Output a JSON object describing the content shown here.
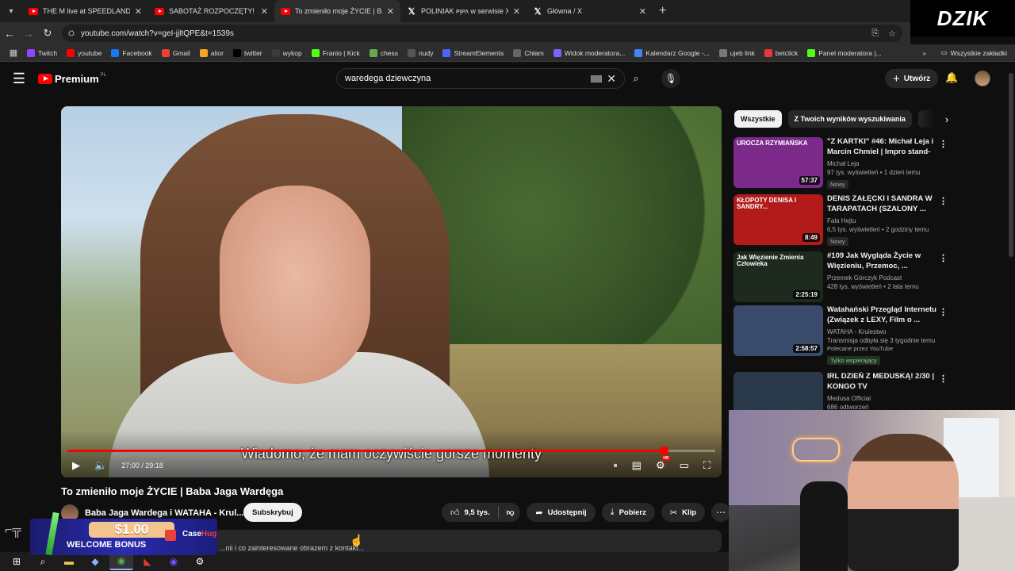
{
  "browser": {
    "tabs": [
      {
        "title": "THE M live at SPEEDLAND FEST",
        "icon": "youtube-icon"
      },
      {
        "title": "SABOTAŻ ROZPOCZĘTY! SABOT",
        "icon": "youtube-icon"
      },
      {
        "title": "To zmieniło moje ŻYCIE | Baba",
        "icon": "youtube-icon",
        "active": true
      },
      {
        "title": "POLINIAK ᴘᴉᴘᴧ w serwisie X: „Do",
        "icon": "x-icon"
      },
      {
        "title": "Główna / X",
        "icon": "x-icon"
      }
    ],
    "url": "youtube.com/watch?v=geI-jjltQPE&t=1539s",
    "overlay_logo": "DZIK",
    "bookmarks": [
      "Twitch",
      "youtube",
      "Facebook",
      "Gmail",
      "alior",
      "twitter",
      "wykop",
      "Franio | Kick",
      "chess",
      "nudy",
      "StreamElements",
      "Chłam",
      "Widok moderatora...",
      "Kalendarz Google -...",
      "ujeb link",
      "betclick",
      "Panel moderatora |..."
    ],
    "all_bookmarks": "Wszystkie zakładki"
  },
  "youtube": {
    "logo": "Premium",
    "logo_region": "PL",
    "search_query": "waredega dziewczyna",
    "create_label": "Utwórz"
  },
  "player": {
    "caption": "Wiadomo, że mam oczywiście gorsze momenty",
    "time": "27:00 / 29:18",
    "progress": 0.921
  },
  "video": {
    "title": "To zmieniło moje ŻYCIE | Baba Jaga Wardęga",
    "channel": "Baba Jaga Wardega i WATAHA - Krul...",
    "subscribe": "Subskrybuj",
    "likes": "9,5 tys.",
    "share": "Udostępnij",
    "download": "Pobierz",
    "clip": "Klip",
    "description_snippet": "...nii i co zainteresowane obrazem z kontakt..."
  },
  "sidebar": {
    "chips": [
      "Wszystkie",
      "Z Twoich wyników wyszukiwania"
    ],
    "recommendations": [
      {
        "title": "\"Z KARTKI\" #46: Michał Leja i Marcin Chmiel | Impro stand-u...",
        "channel": "Michał Leja",
        "views": "97 tys. wyświetleń • 1 dzień temu",
        "badge": "Nowy",
        "duration": "57:37",
        "thumb_text": "UROCZA RZYMIAŃSKA",
        "thumb_bg": "#7b2a8a"
      },
      {
        "title": "DENIS ZAŁĘCKI I SANDRA W TARAPATACH (SZALONY ...",
        "channel": "Fala Hejtu",
        "views": "6,5 tys. wyświetleń • 2 godziny temu",
        "badge": "Nowy",
        "duration": "8:49",
        "thumb_text": "KŁOPOTY DENISA I SANDRY...",
        "thumb_bg": "#b31a1a"
      },
      {
        "title": "#109 Jak Wygląda Życie w Więzieniu, Przemoc, ...",
        "channel": "Przemek Górczyk Podcast",
        "views": "428 tys. wyświetleń • 2 lata temu",
        "badge": "",
        "duration": "2:25:19",
        "thumb_text": "Jak Więzienie Zmienia Człowieka",
        "thumb_bg": "#1f2a1f"
      },
      {
        "title": "Watahański Przegląd Internetu (Związek z LEXY, Film o ...",
        "channel": "WATAHA - Krulestwo",
        "views": "Transmisja odbyła się 3 tygodnie temu",
        "promo": "Polecane przez YouTube",
        "members": "Tylko wspierający",
        "duration": "2:58:57",
        "thumb_text": "",
        "thumb_bg": "#3a4a6a"
      },
      {
        "title": "IRL DZIEŃ Z MEDUSKĄ! 2/30 | KONGO TV",
        "channel": "Medusa Official",
        "views": "686 odtworzeń",
        "badge": "",
        "duration": "",
        "thumb_text": "",
        "thumb_bg": "#2a3a4a"
      }
    ]
  },
  "ad": {
    "amount": "$1.00",
    "text": "WELCOME BONUS",
    "brand": "Case",
    "brand_accent": "Hug"
  },
  "colors": {
    "accent": "#ff0000",
    "bg": "#0f0f0f"
  }
}
